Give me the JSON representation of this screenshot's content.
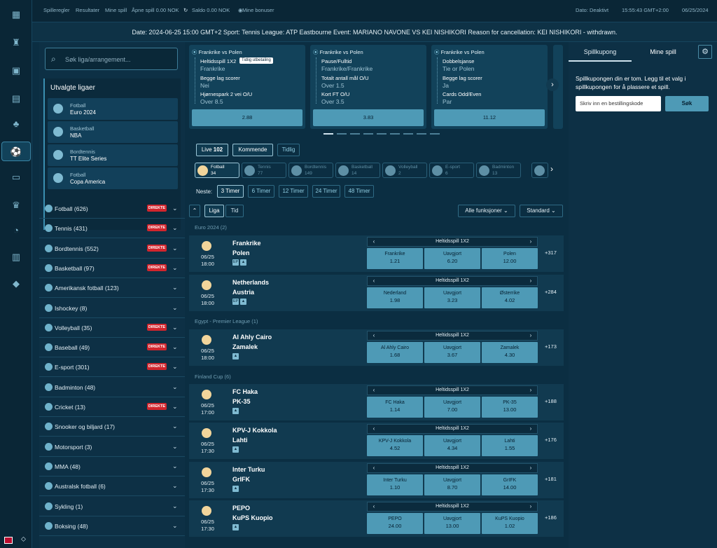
{
  "topbar": {
    "links": [
      "Spilleregler",
      "Resultater",
      "Mine spill",
      "Åpne spill 0.00 NOK",
      "Saldo 0.00 NOK",
      "Mine bonuser"
    ],
    "date_label": "Dato: Deaktivt",
    "clock": "15:55:43 GMT+2:00",
    "date": "06/25/2024"
  },
  "info": "Date: 2024-06-25 15:00 GMT+2 Sport: Tennis      League: ATP Eastbourne Event: MARIANO NAVONE VS KEI NISHIKORI Reason for cancellation: KEI NISHIKORI - withdrawn.",
  "search": {
    "placeholder": "Søk liga/arrangement..."
  },
  "featured": {
    "title": "Utvalgte ligaer",
    "items": [
      {
        "sport": "Fotball",
        "name": "Euro 2024"
      },
      {
        "sport": "Basketball",
        "name": "NBA"
      },
      {
        "sport": "Bordtennis",
        "name": "TT Elite Series"
      },
      {
        "sport": "Fotball",
        "name": "Copa America"
      }
    ]
  },
  "badge_label": "DIREKTE",
  "sports": [
    {
      "name": "Fotball",
      "count": "(626)",
      "live": true
    },
    {
      "name": "Tennis",
      "count": "(431)",
      "live": true
    },
    {
      "name": "Bordtennis",
      "count": "(552)",
      "live": true
    },
    {
      "name": "Basketball",
      "count": "(97)",
      "live": true
    },
    {
      "name": "Amerikansk fotball",
      "count": "(123)",
      "live": false
    },
    {
      "name": "Ishockey",
      "count": "(8)",
      "live": false
    },
    {
      "name": "Volleyball",
      "count": "(35)",
      "live": true
    },
    {
      "name": "Baseball",
      "count": "(49)",
      "live": true
    },
    {
      "name": "E-sport",
      "count": "(301)",
      "live": true
    },
    {
      "name": "Badminton",
      "count": "(48)",
      "live": false
    },
    {
      "name": "Cricket",
      "count": "(13)",
      "live": true
    },
    {
      "name": "Snooker og biljard",
      "count": "(17)",
      "live": false
    },
    {
      "name": "Motorsport",
      "count": "(3)",
      "live": false
    },
    {
      "name": "MMA",
      "count": "(48)",
      "live": false
    },
    {
      "name": "Australsk fotball",
      "count": "(6)",
      "live": false
    },
    {
      "name": "Sykling",
      "count": "(1)",
      "live": false
    },
    {
      "name": "Boksing",
      "count": "(48)",
      "live": false
    }
  ],
  "coupons": [
    {
      "title": "Frankrike vs Polen",
      "tag": "Tidlig utbetaling",
      "m1": "Heltidsspill 1X2",
      "o1": "Frankrike",
      "m2": "Begge lag scorer",
      "o2": "Nei",
      "m3": "Hjørnespark 2 vei O/U",
      "o3": "Over 8.5",
      "odds": "2.88"
    },
    {
      "title": "Frankrike vs Polen",
      "tag": "",
      "m1": "Pause/Fulltid",
      "o1": "Frankrike/Frankrike",
      "m2": "Totalt antall mål O/U",
      "o2": "Over 1.5",
      "m3": "Kort FT O/U",
      "o3": "Over 3.5",
      "odds": "3.83"
    },
    {
      "title": "Frankrike vs Polen",
      "tag": "",
      "m1": "Dobbelsjanse",
      "o1": "Tie or Polen",
      "m2": "Begge lag scorer",
      "o2": "Ja",
      "m3": "Cards Odd/Even",
      "o3": "Par",
      "odds": "11.12"
    }
  ],
  "tabs": [
    {
      "label": "Live",
      "count": "102"
    },
    {
      "label": "Kommende"
    },
    {
      "label": "Tidlig"
    }
  ],
  "sport_tabs": [
    {
      "name": "Fotball",
      "count": "34"
    },
    {
      "name": "Tennis",
      "count": "77"
    },
    {
      "name": "Bordtennis",
      "count": "149"
    },
    {
      "name": "Basketball",
      "count": "14"
    },
    {
      "name": "Volleyball",
      "count": "2"
    },
    {
      "name": "E-sport",
      "count": "6"
    },
    {
      "name": "Badminton",
      "count": "13"
    }
  ],
  "next": {
    "label": "Neste:",
    "options": [
      "3 Timer",
      "6 Timer",
      "12 Timer",
      "24 Timer",
      "48 Timer"
    ]
  },
  "view": {
    "liga": "Liga",
    "tid": "Tid",
    "filter": "Alle funksjoner",
    "sort": "Standard"
  },
  "groups": [
    "Euro 2024 (2)",
    "Egypt - Premier League (1)",
    "Finland Cup (6)"
  ],
  "market_name": "Heltidsspill 1X2",
  "events": [
    {
      "date": "06/25",
      "time": "18:00",
      "home": "Frankrike",
      "away": "Polen",
      "icons": [
        "EP",
        "▲"
      ],
      "b": [
        {
          "n": "Frankrike",
          "o": "1.21"
        },
        {
          "n": "Uavgjort",
          "o": "6.20"
        },
        {
          "n": "Polen",
          "o": "12.00"
        }
      ],
      "more": "+317"
    },
    {
      "date": "06/25",
      "time": "18:00",
      "home": "Netherlands",
      "away": "Austria",
      "icons": [
        "EP",
        "▲"
      ],
      "b": [
        {
          "n": "Nederland",
          "o": "1.98"
        },
        {
          "n": "Uavgjort",
          "o": "3.23"
        },
        {
          "n": "Østerrike",
          "o": "4.02"
        }
      ],
      "more": "+284"
    },
    {
      "date": "06/25",
      "time": "18:00",
      "home": "Al Ahly Cairo",
      "away": "Zamalek",
      "icons": [
        "▲"
      ],
      "b": [
        {
          "n": "Al Ahly Cairo",
          "o": "1.68"
        },
        {
          "n": "Uavgjort",
          "o": "3.67"
        },
        {
          "n": "Zamalek",
          "o": "4.30"
        }
      ],
      "more": "+173"
    },
    {
      "date": "06/25",
      "time": "17:00",
      "home": "FC Haka",
      "away": "PK-35",
      "icons": [
        "▲"
      ],
      "b": [
        {
          "n": "FC Haka",
          "o": "1.14"
        },
        {
          "n": "Uavgjort",
          "o": "7.00"
        },
        {
          "n": "PK-35",
          "o": "13.00"
        }
      ],
      "more": "+188"
    },
    {
      "date": "06/25",
      "time": "17:30",
      "home": "KPV-J Kokkola",
      "away": "Lahti",
      "icons": [
        "▲"
      ],
      "b": [
        {
          "n": "KPV-J Kokkola",
          "o": "4.52"
        },
        {
          "n": "Uavgjort",
          "o": "4.34"
        },
        {
          "n": "Lahti",
          "o": "1.55"
        }
      ],
      "more": "+176"
    },
    {
      "date": "06/25",
      "time": "17:30",
      "home": "Inter Turku",
      "away": "GrIFK",
      "icons": [
        "▲"
      ],
      "b": [
        {
          "n": "Inter Turku",
          "o": "1.10"
        },
        {
          "n": "Uavgjort",
          "o": "8.70"
        },
        {
          "n": "GrIFK",
          "o": "14.00"
        }
      ],
      "more": "+181"
    },
    {
      "date": "06/25",
      "time": "17:30",
      "home": "PEPO",
      "away": "KuPS Kuopio",
      "icons": [
        "▲"
      ],
      "b": [
        {
          "n": "PEPO",
          "o": "24.00"
        },
        {
          "n": "Uavgjort",
          "o": "13.00"
        },
        {
          "n": "KuPS Kuopio",
          "o": "1.02"
        }
      ],
      "more": "+186"
    }
  ],
  "coupon_panel": {
    "tab1": "Spillkupong",
    "tab2": "Mine spill",
    "empty": "Spillkupongen din er tom. Legg til et valg i spillkupongen for å plassere et spill.",
    "placeholder": "Skriv inn en bestillingskode",
    "search": "Søk"
  },
  "colors": {
    "bg": "#0b2e42",
    "odds_button": "#4e9ab6",
    "live_badge": "#d1252d"
  }
}
